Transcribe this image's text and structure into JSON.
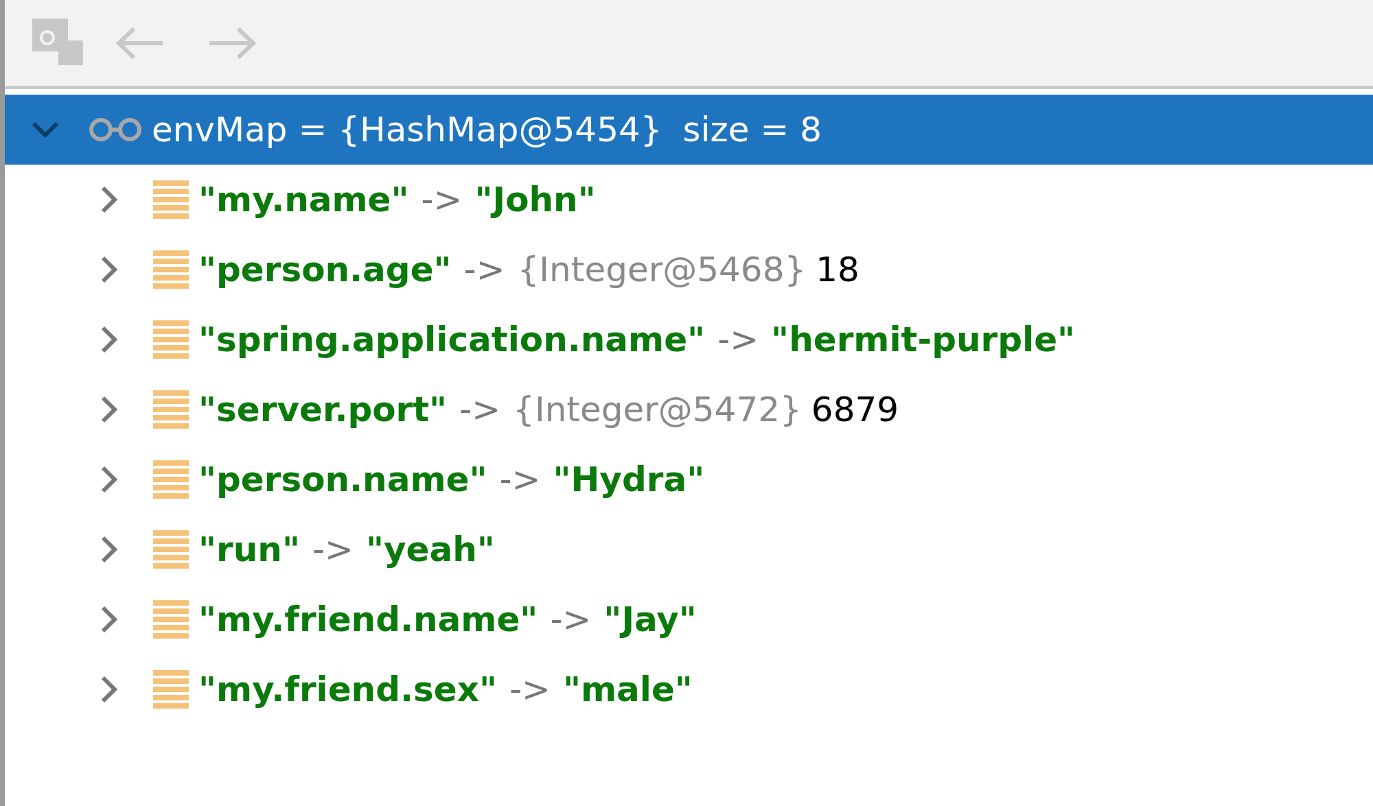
{
  "toolbar": {
    "buttons": [
      {
        "kind": "layout",
        "disabled": true
      },
      {
        "kind": "back",
        "disabled": true
      },
      {
        "kind": "forward",
        "disabled": true
      }
    ]
  },
  "tree": {
    "root": {
      "label": "envMap = {HashMap@5454}",
      "size": "size = 8",
      "expanded": true,
      "selected": true,
      "children": [
        {
          "key": "\"my.name\"",
          "separator": "->",
          "kind": "string",
          "value": "\"John\"",
          "expanded": false
        },
        {
          "key": "\"person.age\"",
          "separator": "->",
          "kind": "object",
          "type": "{Integer@5468}",
          "value": "18",
          "expanded": false
        },
        {
          "key": "\"spring.application.name\"",
          "separator": "->",
          "kind": "string",
          "value": "\"hermit-purple\"",
          "expanded": false
        },
        {
          "key": "\"server.port\"",
          "separator": "->",
          "kind": "object",
          "type": "{Integer@5472}",
          "value": "6879",
          "expanded": false
        },
        {
          "key": "\"person.name\"",
          "separator": "->",
          "kind": "string",
          "value": "\"Hydra\"",
          "expanded": false
        },
        {
          "key": "\"run\"",
          "separator": "->",
          "kind": "string",
          "value": "\"yeah\"",
          "expanded": false
        },
        {
          "key": "\"my.friend.name\"",
          "separator": "->",
          "kind": "string",
          "value": "\"Jay\"",
          "expanded": false
        },
        {
          "key": "\"my.friend.sex\"",
          "separator": "->",
          "kind": "string",
          "value": "\"male\"",
          "expanded": false
        }
      ]
    }
  }
}
